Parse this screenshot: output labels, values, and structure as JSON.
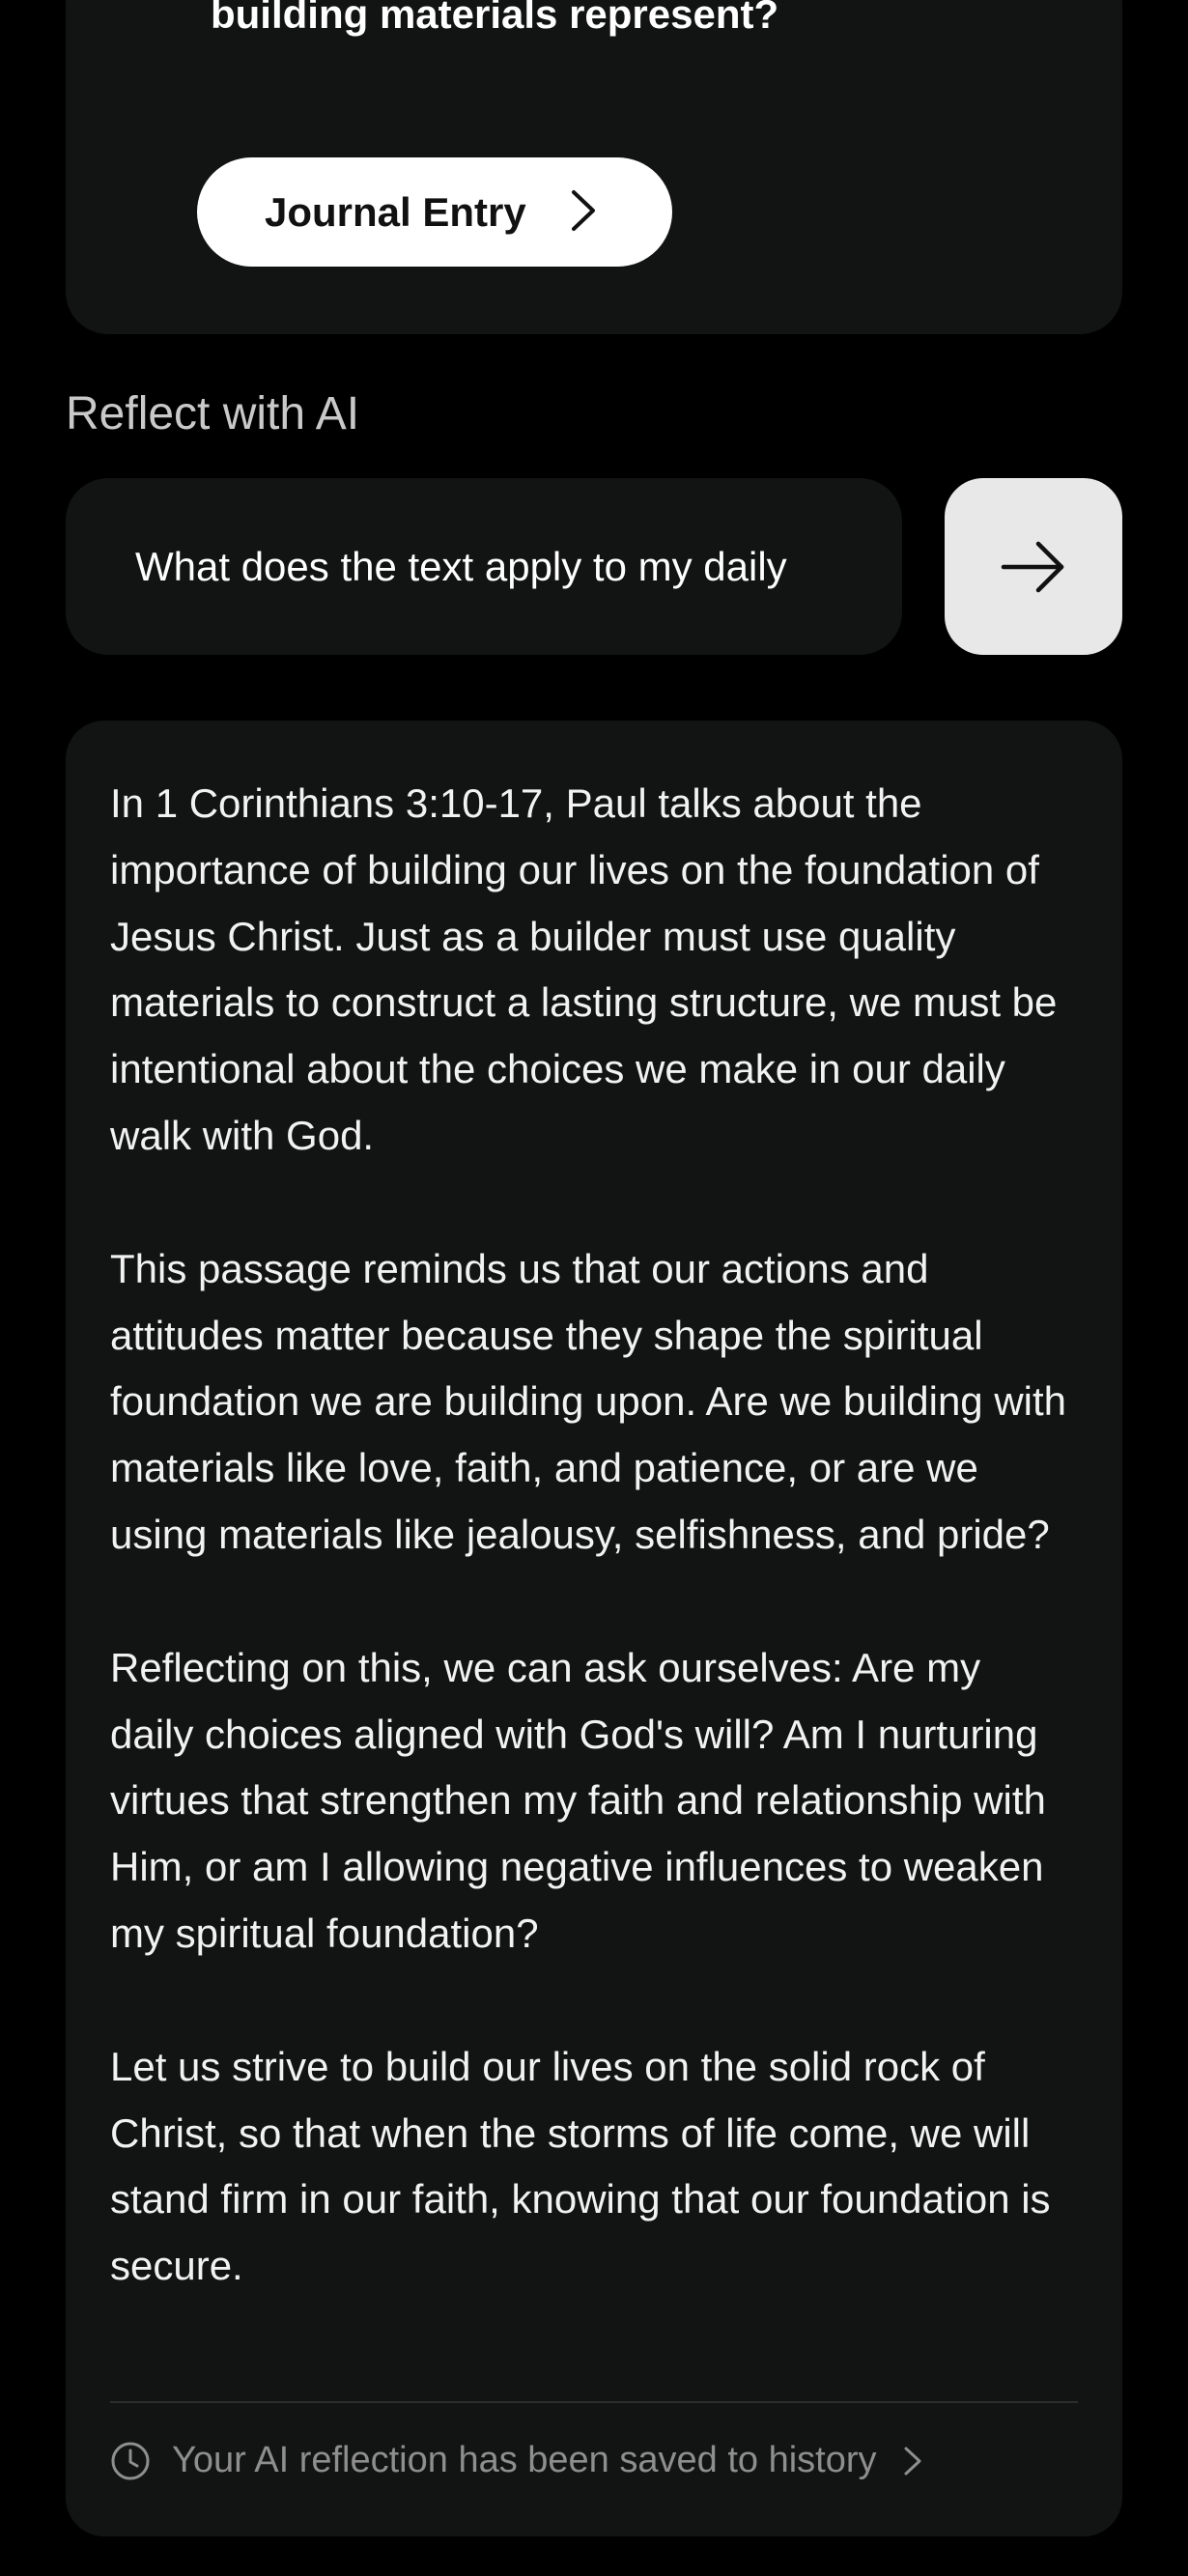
{
  "journal_card": {
    "question_fragment": "building materials represent?",
    "journal_button_label": "Journal Entry"
  },
  "reflect": {
    "section_title": "Reflect with AI",
    "input_value": "What does the text apply to my daily"
  },
  "answer": {
    "paragraphs": [
      "In 1 Corinthians 3:10-17, Paul talks about the importance of building our lives on the foundation of Jesus Christ. Just as a builder must use quality materials to construct a lasting structure, we must be intentional about the choices we make in our daily walk with God.",
      "This passage reminds us that our actions and attitudes matter because they shape the spiritual foundation we are building upon. Are we building with materials like love, faith, and patience, or are we using materials like jealousy, selfishness, and pride?",
      "Reflecting on this, we can ask ourselves: Are my daily choices aligned with God's will? Am I nurturing virtues that strengthen my faith and relationship with Him, or am I allowing negative influences to weaken my spiritual foundation?",
      "Let us strive to build our lives on the solid rock of Christ, so that when the storms of life come, we will stand firm in our faith, knowing that our foundation is secure."
    ],
    "saved_notice": "Your AI reflection has been saved to history"
  },
  "icons": {
    "journal_chevron": "chevron-right-icon",
    "send": "arrow-right-icon",
    "history": "clock-icon",
    "history_chevron": "chevron-right-icon"
  },
  "colors": {
    "background": "#000000",
    "card": "#121313",
    "button_light": "#ffffff",
    "send_button": "#e8e8e8",
    "muted_text": "#8e8e8e"
  }
}
